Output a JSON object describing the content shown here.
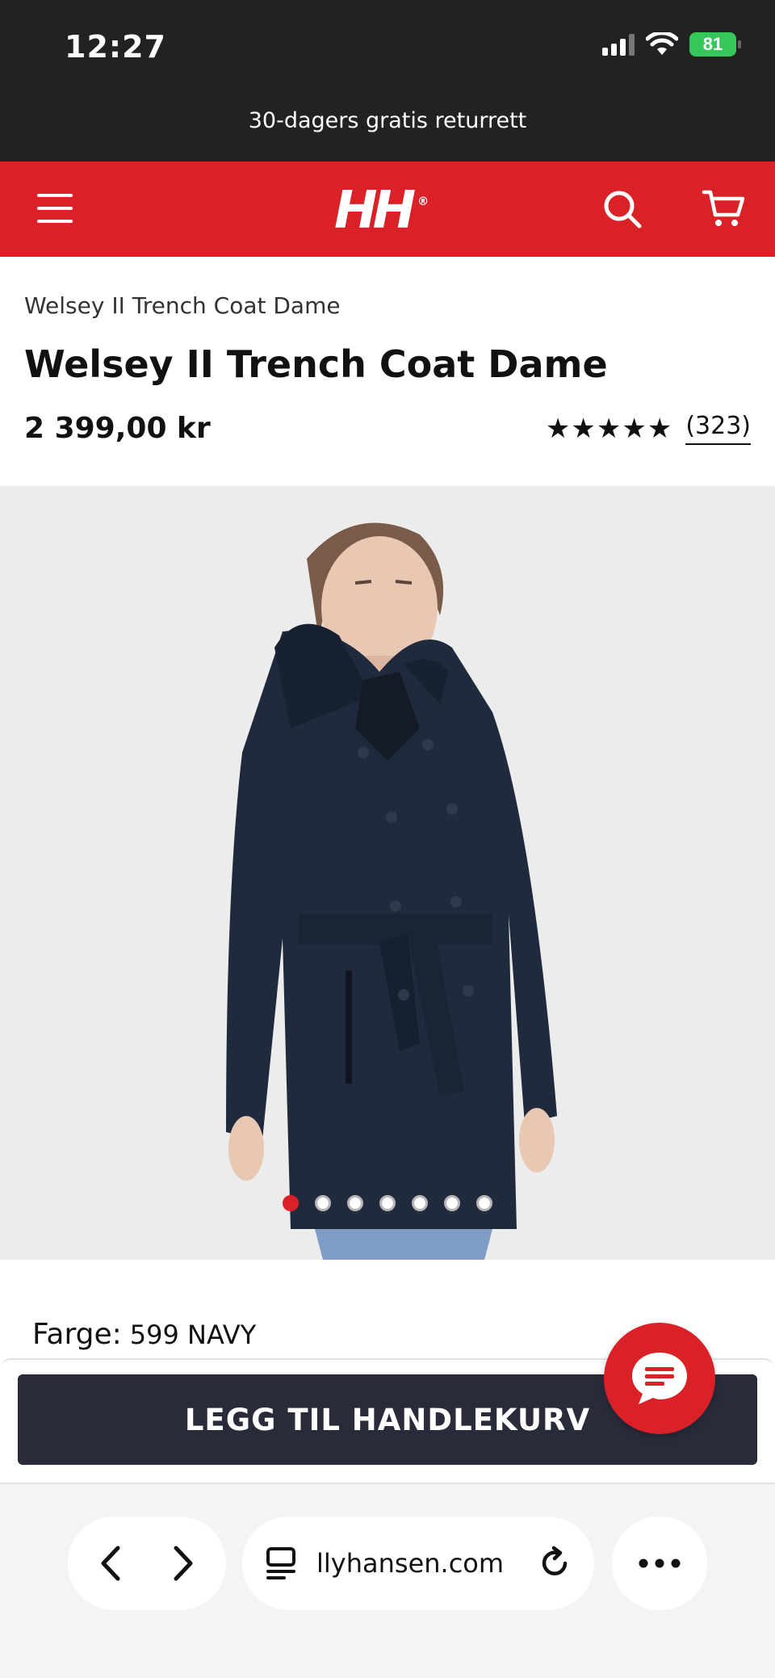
{
  "status_bar": {
    "time": "12:27",
    "battery": "81"
  },
  "promo_banner": "30-dagers gratis returrett",
  "header": {
    "logo_text": "HH",
    "icons": [
      "menu-icon",
      "search-icon",
      "cart-icon"
    ],
    "brand_color": "#da2128"
  },
  "product": {
    "breadcrumb": "Welsey II Trench Coat Dame",
    "title": "Welsey II Trench Coat Dame",
    "price": "2 399,00 kr",
    "rating_stars": 5,
    "review_count": "(323)",
    "image_count": 7,
    "active_image_index": 0,
    "color_label": "Farge:",
    "color_value": "599 NAVY"
  },
  "cart": {
    "add_button_label": "LEGG TIL HANDLEKURV"
  },
  "browser": {
    "url": "llyhansen.com"
  }
}
